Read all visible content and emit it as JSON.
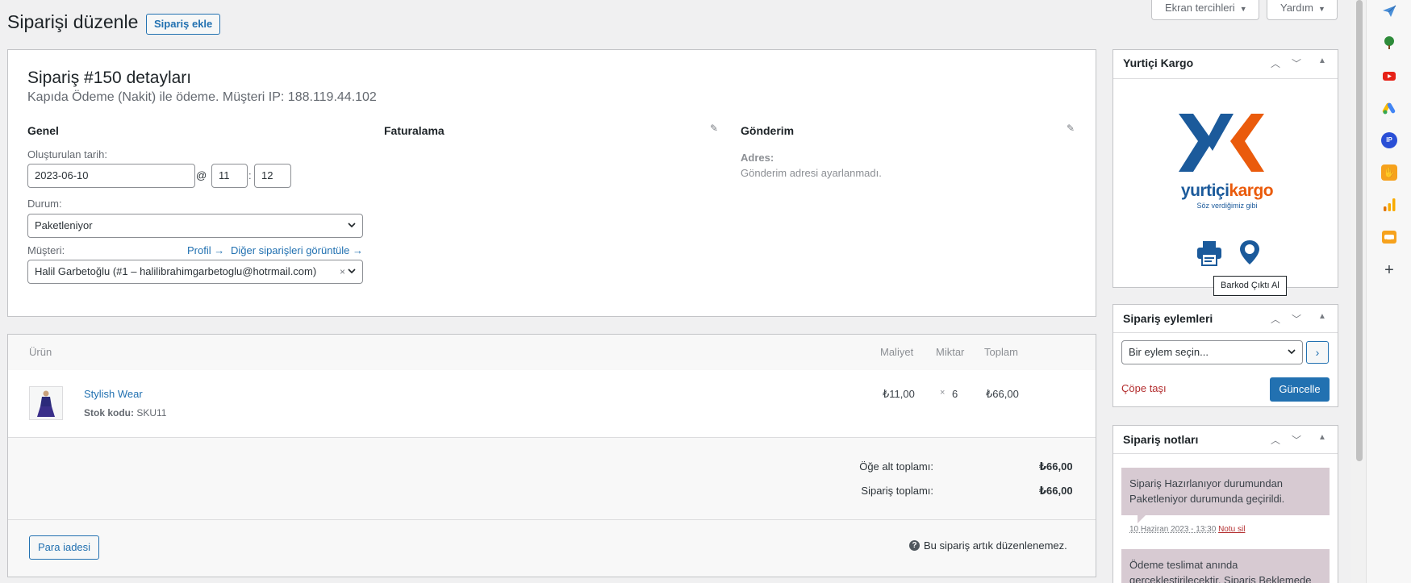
{
  "header": {
    "title": "Siparişi düzenle",
    "add_button": "Sipariş ekle",
    "screen_options": "Ekran tercihleri",
    "help": "Yardım"
  },
  "order": {
    "heading": "Sipariş #150 detayları",
    "subtitle": "Kapıda Ödeme (Nakit) ile ödeme. Müşteri IP: 188.119.44.102",
    "general": {
      "title": "Genel",
      "created_label": "Oluşturulan tarih:",
      "date": "2023-06-10",
      "at": "@",
      "hour": "11",
      "sep": ":",
      "minute": "12",
      "status_label": "Durum:",
      "status_value": "Paketleniyor",
      "customer_label": "Müşteri:",
      "profile_link": "Profil →",
      "other_orders_link": "Diğer siparişleri görüntüle →",
      "customer_value": "Halil Garbetoğlu (#1 – halilibrahimgarbetoglu@hotrmail.com)",
      "clear": "×"
    },
    "billing": {
      "title": "Faturalama"
    },
    "shipping": {
      "title": "Gönderim",
      "address_label": "Adres:",
      "address_value": "Gönderim adresi ayarlanmadı."
    }
  },
  "items": {
    "headers": {
      "product": "Ürün",
      "cost": "Maliyet",
      "qty": "Miktar",
      "total": "Toplam"
    },
    "rows": [
      {
        "name": "Stylish Wear",
        "sku_label": "Stok kodu:",
        "sku": "SKU11",
        "cost": "₺11,00",
        "qty_x": "×",
        "qty": "6",
        "total": "₺66,00"
      }
    ],
    "subtotal_label": "Öğe alt toplamı:",
    "subtotal": "₺66,00",
    "order_total_label": "Sipariş toplamı:",
    "order_total": "₺66,00",
    "refund_button": "Para iadesi",
    "locked_note": "Bu sipariş artık düzenlenemez."
  },
  "sidebar": {
    "kargo": {
      "title": "Yurtiçi Kargo",
      "logo_text_1": "yurtiçi",
      "logo_text_2": "kargo",
      "logo_tagline": "Söz verdiğimiz gibi",
      "tooltip": "Barkod Çıktı Al"
    },
    "actions": {
      "title": "Sipariş eylemleri",
      "select_value": "Bir eylem seçin...",
      "trash": "Çöpe taşı",
      "update": "Güncelle"
    },
    "notes": {
      "title": "Sipariş notları",
      "items": [
        {
          "text": "Sipariş Hazırlanıyor durumundan Paketleniyor durumunda geçirildi.",
          "date": "10 Haziran 2023 - 13:30",
          "delete": "Notu sil"
        },
        {
          "text": "Ödeme teslimat anında gerçekleştirilecektir. Sipariş Beklemede"
        }
      ]
    }
  },
  "colors": {
    "accent": "#2271b1",
    "kargo_blue": "#1b5a9b",
    "kargo_orange": "#ea5b0c",
    "note_bg": "#d7cad2"
  }
}
